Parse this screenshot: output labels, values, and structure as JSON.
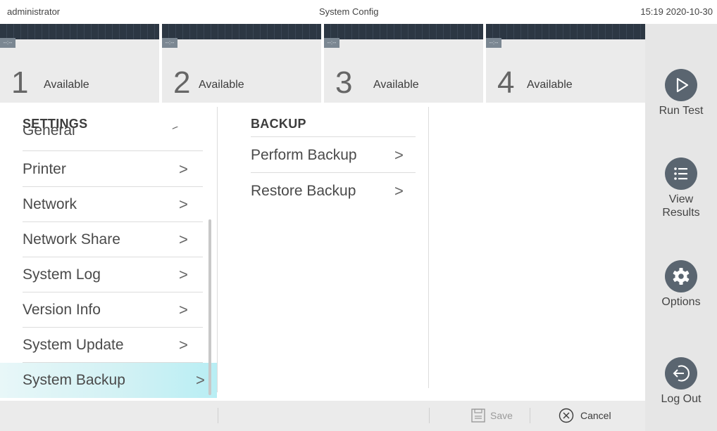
{
  "topbar": {
    "user": "administrator",
    "title": "System Config",
    "clock": "15:19 2020-10-30"
  },
  "modules": [
    {
      "number": "1",
      "status": "Available"
    },
    {
      "number": "2",
      "status": "Available"
    },
    {
      "number": "3",
      "status": "Available"
    },
    {
      "number": "4",
      "status": "Available"
    }
  ],
  "module_lock_text": "--:--",
  "sidebar": {
    "run_test": "Run Test",
    "view_results_1": "View",
    "view_results_2": "Results",
    "options": "Options",
    "log_out": "Log Out"
  },
  "settings": {
    "heading": "SETTINGS",
    "clipped_item": "General",
    "items": [
      "Printer",
      "Network",
      "Network Share",
      "System Log",
      "Version Info",
      "System Update",
      "System Backup"
    ],
    "active": "System Backup",
    "chevron": ">"
  },
  "backup": {
    "heading": "BACKUP",
    "items": [
      "Perform Backup",
      "Restore Backup"
    ]
  },
  "bottombar": {
    "save": "Save",
    "cancel": "Cancel"
  },
  "colors": {
    "accent_active": "#b8eef4",
    "sidebar_icon": "#5a6570",
    "module_strip": "#2c3743"
  }
}
